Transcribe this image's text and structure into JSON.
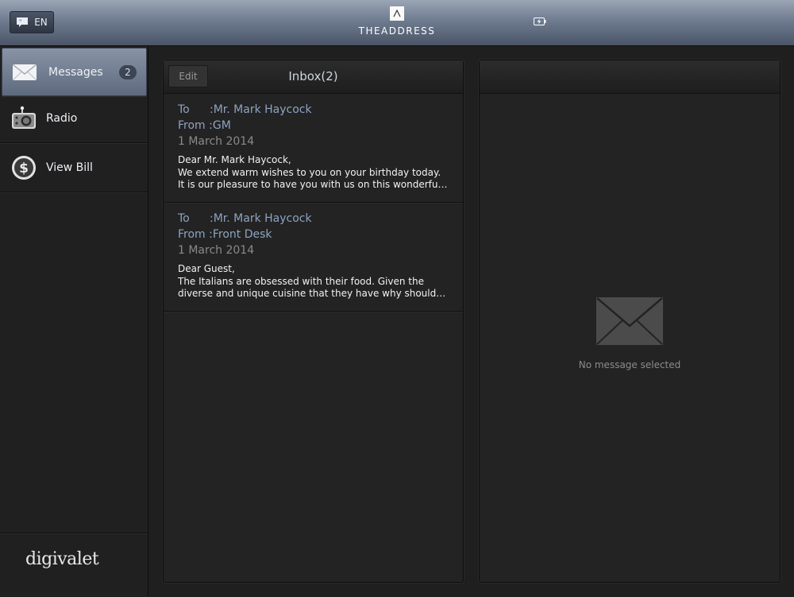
{
  "header": {
    "language": "EN",
    "brand_name": "THEADDRESS",
    "logo_glyph": "Λ"
  },
  "sidebar": {
    "items": [
      {
        "label": "Messages",
        "icon": "envelope-icon",
        "badge": "2",
        "active": true
      },
      {
        "label": "Radio",
        "icon": "radio-icon"
      },
      {
        "label": "View Bill",
        "icon": "dollar-coin-icon"
      }
    ],
    "brand": "digivalet"
  },
  "inbox": {
    "edit_label": "Edit",
    "title": "Inbox(2)",
    "messages": [
      {
        "to_label": "To",
        "to": ":Mr. Mark Haycock",
        "from_label": "From",
        "from": ":GM",
        "date": "1 March 2014",
        "line1": "Dear Mr. Mark Haycock,",
        "line2": "We extend warm wishes to you on your birthday today.",
        "line3": "It is our pleasure to have you with us on this wonderfu…"
      },
      {
        "to_label": "To",
        "to": ":Mr. Mark Haycock",
        "from_label": "From",
        "from": ":Front Desk",
        "date": "1 March 2014",
        "line1": "Dear Guest,",
        "line2": "The Italians are obsessed with their food. Given the",
        "line3": "diverse and unique cuisine that they have why should…"
      }
    ]
  },
  "detail": {
    "empty_text": "No message selected"
  },
  "colors": {
    "accent_blue": "#8ea3c2",
    "topbar": "#6f7c90",
    "background": "#1f1f1f"
  }
}
